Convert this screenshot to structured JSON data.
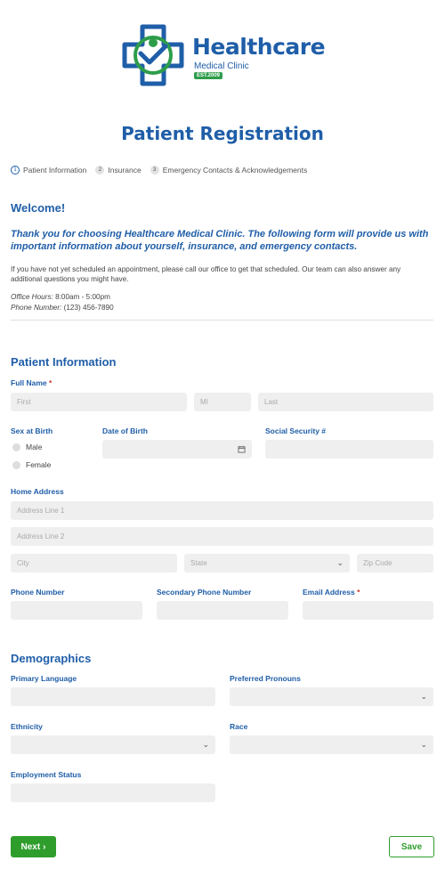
{
  "logo": {
    "brand": "Healthcare",
    "sub": "Medical Clinic",
    "est": "EST.2009"
  },
  "page_title": "Patient Registration",
  "steps": [
    {
      "num": "1",
      "label": "Patient Information"
    },
    {
      "num": "2",
      "label": "Insurance"
    },
    {
      "num": "3",
      "label": "Emergency Contacts & Acknowledgements"
    }
  ],
  "welcome": {
    "heading": "Welcome!",
    "intro": "Thank you for choosing Healthcare Medical Clinic.  The following form will provide us with important information about yourself, insurance, and emergency contacts.",
    "note": "If you have not yet scheduled an appointment, please call our office to get that scheduled. Our team can also answer any additional questions you might have.",
    "hours_label": "Office Hours:",
    "hours_value": "8:00am - 5:00pm",
    "phone_label": "Phone Number:",
    "phone_value": "(123) 456-7890"
  },
  "patient": {
    "heading": "Patient Information",
    "full_name_label": "Full Name",
    "first_ph": "First",
    "mi_ph": "MI",
    "last_ph": "Last",
    "sex_label": "Sex at Birth",
    "sex_options": [
      "Male",
      "Female"
    ],
    "dob_label": "Date of Birth",
    "ssn_label": "Social Security #",
    "address_label": "Home Address",
    "addr1_ph": "Address Line 1",
    "addr2_ph": "Address Line 2",
    "city_ph": "City",
    "state_ph": "State",
    "zip_ph": "Zip Code",
    "phone_label": "Phone Number",
    "phone2_label": "Secondary Phone Number",
    "email_label": "Email Address"
  },
  "demographics": {
    "heading": "Demographics",
    "language_label": "Primary Language",
    "pronouns_label": "Preferred Pronouns",
    "ethnicity_label": "Ethnicity",
    "race_label": "Race",
    "employment_label": "Employment Status"
  },
  "buttons": {
    "next": "Next",
    "save": "Save"
  },
  "colors": {
    "primary": "#1f5ea8",
    "accent": "#2e9d2c",
    "required": "#d0342c",
    "field_bg": "#efefef"
  },
  "icons": {
    "calendar": "calendar-icon",
    "chevron": "chevron-down-icon",
    "next": "chevron-right-icon"
  }
}
